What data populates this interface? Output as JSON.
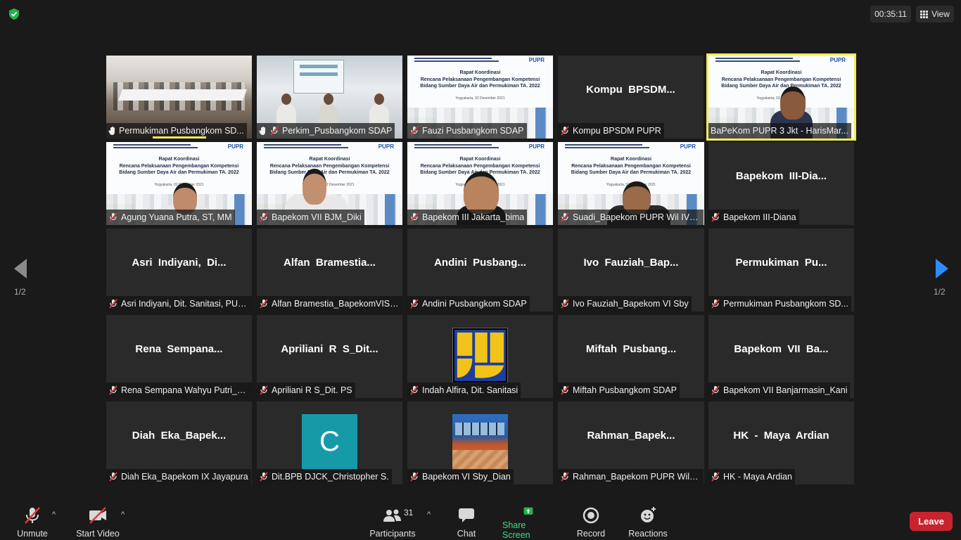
{
  "topbar": {
    "timer": "00:35:11",
    "view_label": "View"
  },
  "pager": {
    "left": "1/2",
    "right": "1/2"
  },
  "slide_text": {
    "logo": "PUPR",
    "title1": "Rapat Koordinasi",
    "title2": "Rencana Pelaksanaan Pengembangan Kompetensi",
    "title3": "Bidang Sumber Daya Air dan Permukiman TA. 2022",
    "date": "Yogyakarta, 02 Desember 2021"
  },
  "participants": [
    {
      "label": "Permukiman Pusbangkom SD...",
      "center": "",
      "kind": "room",
      "hand": true,
      "muted": false
    },
    {
      "label": "Perkim_Pusbangkom SDAP",
      "center": "",
      "kind": "panel",
      "hand": true,
      "muted": true
    },
    {
      "label": "Fauzi Pusbangkom SDAP",
      "center": "",
      "kind": "slide",
      "muted": true
    },
    {
      "label": "Kompu BPSDM PUPR",
      "center": "Kompu  BPSDM...",
      "kind": "name",
      "muted": true
    },
    {
      "label": "BaPeKom PUPR 3 Jkt - HarisMar...",
      "center": "",
      "kind": "slide-face",
      "muted": false,
      "active": true
    },
    {
      "label": "Agung Yuana Putra, ST, MM",
      "center": "",
      "kind": "slide-face",
      "muted": true
    },
    {
      "label": "Bapekom VII BJM_Diki",
      "center": "",
      "kind": "slide-face",
      "muted": true
    },
    {
      "label": "Bapekom III Jakarta_bima",
      "center": "",
      "kind": "slide-face",
      "muted": true
    },
    {
      "label": "Suadi_Bapekom PUPR Wil IV B...",
      "center": "",
      "kind": "slide-face",
      "muted": true
    },
    {
      "label": "Bapekom III-Diana",
      "center": "Bapekom  III-Dia...",
      "kind": "name",
      "muted": true
    },
    {
      "label": "Asri Indiyani, Dit. Sanitasi, PUPR",
      "center": "Asri  Indiyani,  Di...",
      "kind": "name",
      "muted": true
    },
    {
      "label": "Alfan Bramestia_BapekomVISu...",
      "center": "Alfan  Bramestia...",
      "kind": "name",
      "muted": true
    },
    {
      "label": "Andini Pusbangkom SDAP",
      "center": "Andini  Pusbang...",
      "kind": "name",
      "muted": true
    },
    {
      "label": "Ivo Fauziah_Bapekom VI Sby",
      "center": "Ivo  Fauziah_Bap...",
      "kind": "name",
      "muted": true
    },
    {
      "label": "Permukiman Pusbangkom SD...",
      "center": "Permukiman  Pu...",
      "kind": "name",
      "muted": true
    },
    {
      "label": "Rena Sempana Wahyu Putri_P...",
      "center": "Rena  Sempana...",
      "kind": "name",
      "muted": true
    },
    {
      "label": "Apriliani R S_Dit. PS",
      "center": "Apriliani  R  S_Dit...",
      "kind": "name",
      "muted": true
    },
    {
      "label": "Indah Alfira, Dit. Sanitasi",
      "center": "",
      "kind": "logo",
      "muted": true
    },
    {
      "label": "Miftah Pusbangkom SDAP",
      "center": "Miftah  Pusbang...",
      "kind": "name",
      "muted": true
    },
    {
      "label": "Bapekom VII Banjarmasin_Kani",
      "center": "Bapekom  VII  Ba...",
      "kind": "name",
      "muted": true
    },
    {
      "label": "Diah Eka_Bapekom IX Jayapura",
      "center": "Diah  Eka_Bapek...",
      "kind": "name",
      "muted": true
    },
    {
      "label": "Dit.BPB DJCK_Christopher S.",
      "center": "C",
      "kind": "avatar",
      "muted": true
    },
    {
      "label": "Bapekom VI Sby_Dian",
      "center": "",
      "kind": "photo",
      "muted": true
    },
    {
      "label": "Rahman_Bapekom PUPR Wila...",
      "center": "Rahman_Bapek...",
      "kind": "name",
      "muted": true
    },
    {
      "label": "HK - Maya Ardian",
      "center": "HK  -  Maya  Ardian",
      "kind": "name",
      "muted": true
    }
  ],
  "toolbar": {
    "unmute": "Unmute",
    "start_video": "Start Video",
    "participants": "Participants",
    "participants_count": "31",
    "chat": "Chat",
    "share_screen": "Share Screen",
    "record": "Record",
    "reactions": "Reactions",
    "leave": "Leave"
  },
  "colors": {
    "active_outline": "#f3ec57",
    "leave": "#c8242d",
    "share": "#3ddc84",
    "muted": "#e0393e"
  }
}
